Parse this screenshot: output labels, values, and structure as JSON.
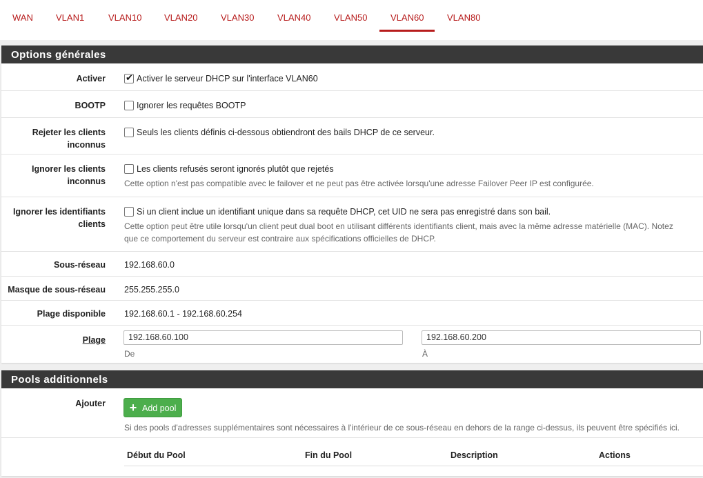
{
  "tabs": [
    {
      "label": "WAN",
      "active": false
    },
    {
      "label": "VLAN1",
      "active": false
    },
    {
      "label": "VLAN10",
      "active": false
    },
    {
      "label": "VLAN20",
      "active": false
    },
    {
      "label": "VLAN30",
      "active": false
    },
    {
      "label": "VLAN40",
      "active": false
    },
    {
      "label": "VLAN50",
      "active": false
    },
    {
      "label": "VLAN60",
      "active": true
    },
    {
      "label": "VLAN80",
      "active": false
    }
  ],
  "colors": {
    "accent": "#b71c1c",
    "heading_bg": "#393939",
    "success": "#4cae4c"
  },
  "general": {
    "title": "Options générales",
    "enable": {
      "label": "Activer",
      "text": "Activer le serveur DHCP sur l'interface VLAN60",
      "checked": true
    },
    "bootp": {
      "label": "BOOTP",
      "text": "Ignorer les requêtes BOOTP",
      "checked": false
    },
    "deny_unknown": {
      "label_1": "Rejeter les clients",
      "label_2": "inconnus",
      "text": "Seuls les clients définis ci-dessous obtiendront des bails DHCP de ce serveur.",
      "checked": false
    },
    "ignore_denied": {
      "label_1": "Ignorer les clients",
      "label_2": "inconnus",
      "text": "Les clients refusés seront ignorés plutôt que rejetés",
      "help": "Cette option n'est pas compatible avec le failover et ne peut pas être activée lorsqu'une adresse Failover Peer IP est configurée.",
      "checked": false
    },
    "ignore_uid": {
      "label_1": "Ignorer les identifiants",
      "label_2": "clients",
      "text": "Si un client inclue un identifiant unique dans sa requête DHCP, cet UID ne sera pas enregistré dans son bail.",
      "help_1": "Cette option peut être utile lorsqu'un client peut dual boot en utilisant différents identifiants client, mais avec la même adresse matérielle (MAC). Notez",
      "help_2": "que ce comportement du serveur est contraire aux spécifications officielles de DHCP.",
      "checked": false
    },
    "subnet": {
      "label": "Sous-réseau",
      "value": "192.168.60.0"
    },
    "mask": {
      "label": "Masque de sous-réseau",
      "value": "255.255.255.0"
    },
    "available": {
      "label": "Plage disponible",
      "value": "192.168.60.1 - 192.168.60.254"
    },
    "range": {
      "label": "Plage",
      "from_value": "192.168.60.100",
      "from_label": "De",
      "to_value": "192.168.60.200",
      "to_label": "À"
    }
  },
  "pools": {
    "title": "Pools additionnels",
    "add_label": "Ajouter",
    "add_button": "Add pool",
    "add_icon": "plus-icon",
    "help": "Si des pools d'adresses supplémentaires sont nécessaires à l'intérieur de ce sous-réseau en dehors de la range ci-dessus, ils peuvent être spécifiés ici.",
    "columns": [
      "Début du Pool",
      "Fin du Pool",
      "Description",
      "Actions"
    ]
  }
}
